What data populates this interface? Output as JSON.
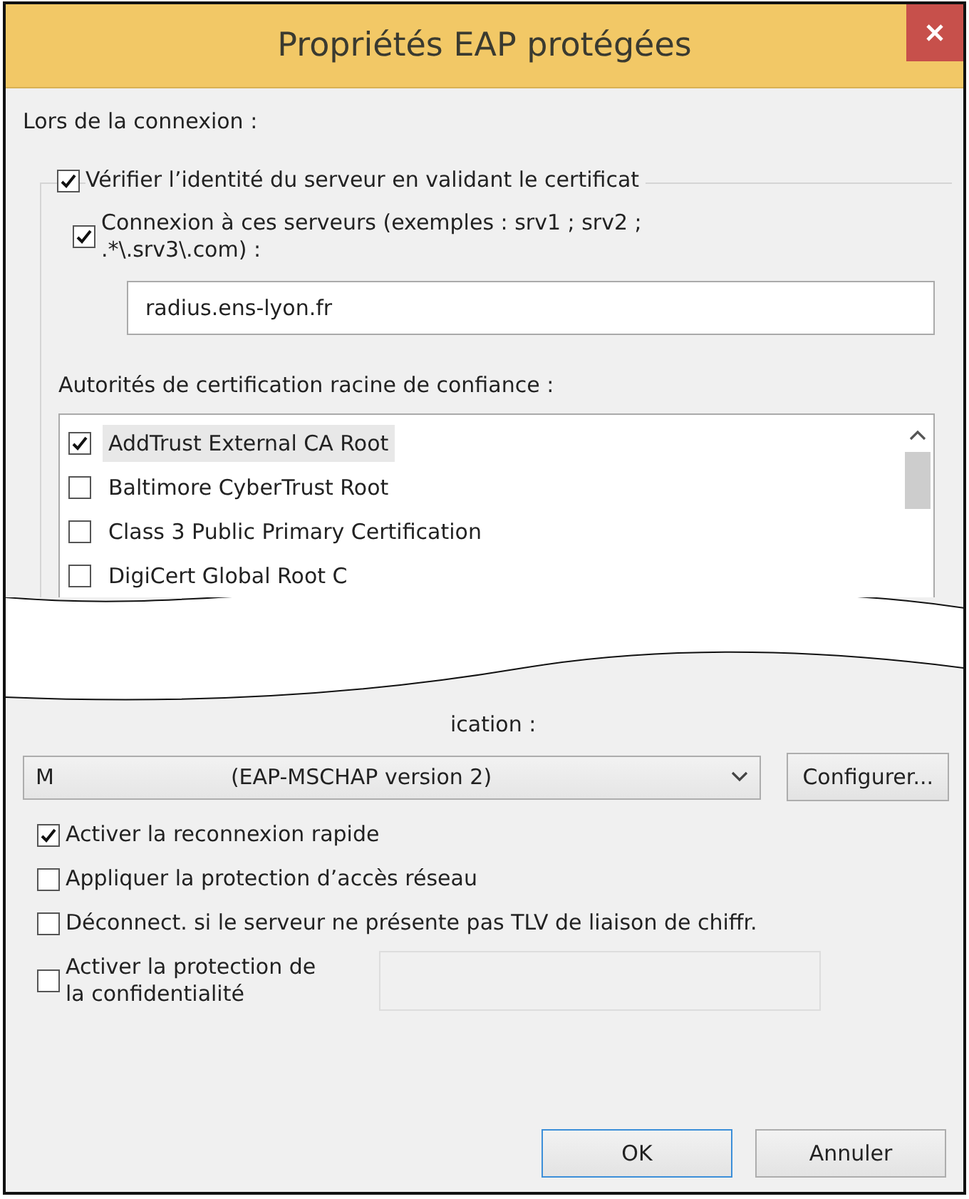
{
  "window": {
    "title": "Propriétés EAP protégées"
  },
  "section_label": "Lors de la connexion :",
  "verify_server": {
    "label": "Vérifier l’identité du serveur en validant le certificat",
    "checked": true
  },
  "connect_servers": {
    "lines": [
      "Connexion à ces serveurs (exemples : srv1 ; srv2 ;",
      ".*\\.srv3\\.com) :"
    ],
    "checked": true,
    "value": "radius.ens-lyon.fr"
  },
  "ca_label": "Autorités de certification racine de confiance :",
  "ca_list": [
    {
      "label": "AddTrust External CA Root",
      "checked": true,
      "selected": true
    },
    {
      "label": "Baltimore CyberTrust Root",
      "checked": false,
      "selected": false
    },
    {
      "label": "Class 3 Public Primary Certification",
      "checked": false,
      "selected": false
    },
    {
      "label": "DigiCert Global Root C",
      "checked": false,
      "selected": false
    }
  ],
  "auth_method_label": "ication :",
  "auth_method": {
    "value_start": "M",
    "value_end": "(EAP-MSCHAP version 2)"
  },
  "configure_button": "Configurer...",
  "options": [
    {
      "lines": [
        "Activer la reconnexion rapide"
      ],
      "checked": true
    },
    {
      "lines": [
        "Appliquer la protection d’accès réseau"
      ],
      "checked": false
    },
    {
      "lines": [
        "Déconnect. si le serveur ne présente pas TLV de liaison de chiffr."
      ],
      "checked": false
    },
    {
      "lines": [
        "Activer la protection de",
        "la confidentialité"
      ],
      "checked": false,
      "kind": "with-field"
    }
  ],
  "buttons": [
    {
      "label": "OK",
      "default": true
    },
    {
      "label": "Annuler",
      "default": false
    }
  ]
}
